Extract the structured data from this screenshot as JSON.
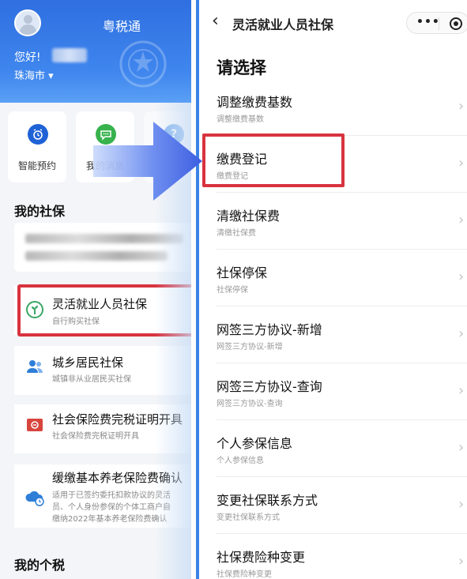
{
  "left": {
    "app_title": "粤税通",
    "greeting": "您好!",
    "city": "珠海市",
    "city_caret": "▾",
    "quick_actions": [
      {
        "label": "智能预约",
        "icon": "alarm-clock-icon",
        "color": "#1f62d6"
      },
      {
        "label": "我的消息",
        "icon": "chat-bubble-icon",
        "color": "#37b24d"
      },
      {
        "label": "帮助",
        "icon": "help-icon",
        "color": "#3d8be8"
      }
    ],
    "section_social": "我的社保",
    "services": [
      {
        "title": "灵活就业人员社保",
        "subtitle": "自行购买社保",
        "icon": "sprout-icon",
        "color": "#3aa664"
      },
      {
        "title": "城乡居民社保",
        "subtitle": "城镇非从业居民买社保",
        "icon": "people-icon",
        "color": "#2e7ed8"
      },
      {
        "title": "社会保险费完税证明开具",
        "subtitle": "社会保险费完税证明开具",
        "icon": "certificate-icon",
        "color": "#d8453c"
      },
      {
        "title": "缓缴基本养老保险费确认",
        "subtitle": "",
        "icon": "cloud-clock-icon",
        "color": "#2e7ed8"
      }
    ],
    "defer_desc": [
      "适用于已签约委托扣款协议的灵活",
      "员、个人身份参保的个体工商户自",
      "缴纳2022年基本养老保险费确认"
    ],
    "section_tax": "我的个税"
  },
  "right": {
    "nav_title": "灵活就业人员社保",
    "back_glyph": "‹",
    "capsule_dots": "•••",
    "heading": "请选择",
    "chevron": "›",
    "options": [
      {
        "title": "调整缴费基数",
        "subtitle": "调整缴费基数"
      },
      {
        "title": "缴费登记",
        "subtitle": "缴费登记"
      },
      {
        "title": "清缴社保费",
        "subtitle": "清缴社保费"
      },
      {
        "title": "社保停保",
        "subtitle": "社保停保"
      },
      {
        "title": "网签三方协议-新增",
        "subtitle": "网签三方协议-新增"
      },
      {
        "title": "网签三方协议-查询",
        "subtitle": "网签三方协议-查询"
      },
      {
        "title": "个人参保信息",
        "subtitle": "个人参保信息"
      },
      {
        "title": "变更社保联系方式",
        "subtitle": "变更社保联系方式"
      },
      {
        "title": "社保费险种变更",
        "subtitle": "社保费险种变更"
      }
    ]
  },
  "colors": {
    "header_blue": "#3f86ee",
    "highlight_red": "#d8333f",
    "arrow_blue": "#4a6fe6"
  }
}
